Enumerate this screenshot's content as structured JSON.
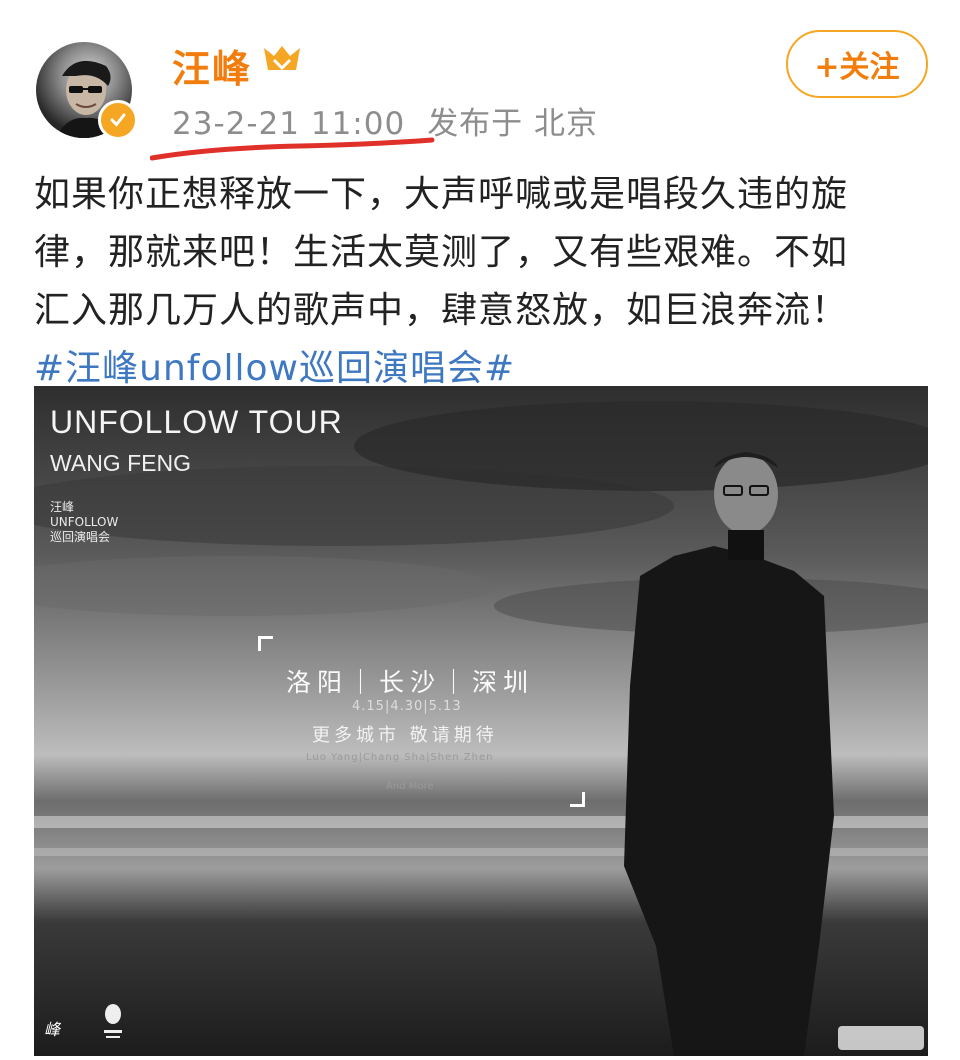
{
  "post": {
    "username": "汪峰",
    "time": "23-2-21 11:00",
    "location": "发布于 北京",
    "follow_label": "+关注",
    "text_lines": [
      "如果你正想释放一下，大声呼喊或是唱段久违的旋",
      "律，那就来吧！生活太莫测了，又有些艰难。不如",
      "汇入那几万人的歌声中，肆意怒放，如巨浪奔流！"
    ],
    "hashtag": "#汪峰unfollow巡回演唱会#"
  },
  "poster": {
    "title": "UNFOLLOW TOUR",
    "artist": "WANG FENG",
    "small_name": "汪峰",
    "small_tour": "UNFOLLOW",
    "small_sub": "巡回演唱会",
    "cities": "洛阳｜长沙｜深圳",
    "dates": "4.15|4.30|5.13",
    "more": "更多城市  敬请期待",
    "pinyin": "Luo Yang|Chang Sha|Shen Zhen",
    "and_more": "And More",
    "signature_logo": "峰"
  },
  "colors": {
    "username": "#f27d0c",
    "hashtag": "#3f78c2",
    "meta": "#8d8d8d",
    "underline": "#e0302a"
  }
}
